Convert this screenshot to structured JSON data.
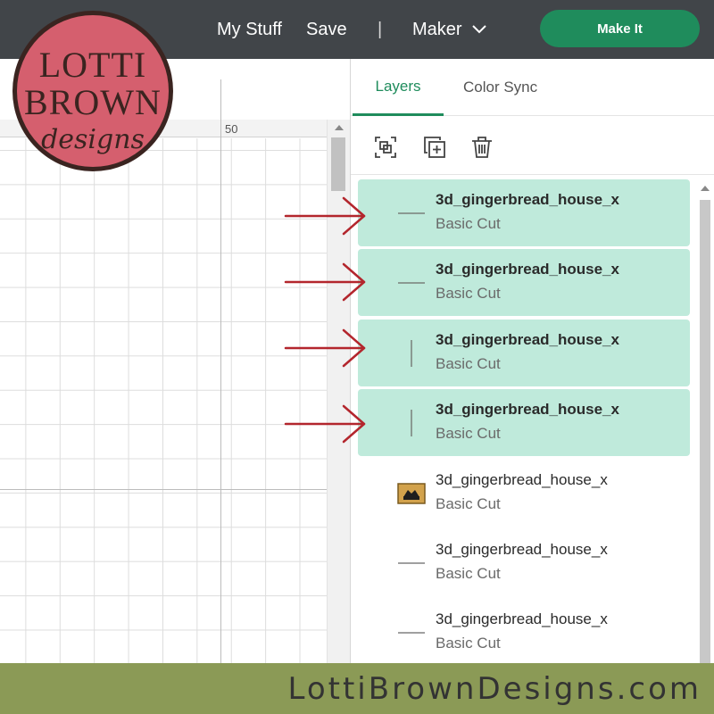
{
  "header": {
    "my_stuff": "My Stuff",
    "save": "Save",
    "separator": "|",
    "machine": "Maker",
    "make_it": "Make It"
  },
  "canvas": {
    "ruler_label": "50"
  },
  "panel": {
    "tabs": [
      {
        "label": "Layers",
        "active": true
      },
      {
        "label": "Color Sync",
        "active": false
      }
    ],
    "toolbar": [
      "group-icon",
      "duplicate-icon",
      "delete-icon"
    ],
    "layers": [
      {
        "name": "3d_gingerbread_house_x",
        "operation": "Basic Cut",
        "selected": true,
        "thumb": "horizontal-line"
      },
      {
        "name": "3d_gingerbread_house_x",
        "operation": "Basic Cut",
        "selected": true,
        "thumb": "horizontal-line"
      },
      {
        "name": "3d_gingerbread_house_x",
        "operation": "Basic Cut",
        "selected": true,
        "thumb": "vertical-line"
      },
      {
        "name": "3d_gingerbread_house_x",
        "operation": "Basic Cut",
        "selected": true,
        "thumb": "vertical-line"
      },
      {
        "name": "3d_gingerbread_house_x",
        "operation": "Basic Cut",
        "selected": false,
        "thumb": "house-shape"
      },
      {
        "name": "3d_gingerbread_house_x",
        "operation": "Basic Cut",
        "selected": false,
        "thumb": "horizontal-line"
      },
      {
        "name": "3d_gingerbread_house_x",
        "operation": "Basic Cut",
        "selected": false,
        "thumb": "horizontal-line"
      }
    ]
  },
  "logo": {
    "line1": "LOTTI",
    "line2": "BROWN",
    "line3": "designs"
  },
  "footer": {
    "text": "LottiBrownDesigns.com"
  },
  "colors": {
    "topbar": "#414549",
    "accent": "#1f8c5c",
    "selected_layer": "#bfeadb",
    "arrow": "#b3262d",
    "logo_fill": "#d55f6e",
    "footer": "#8b9a56"
  }
}
